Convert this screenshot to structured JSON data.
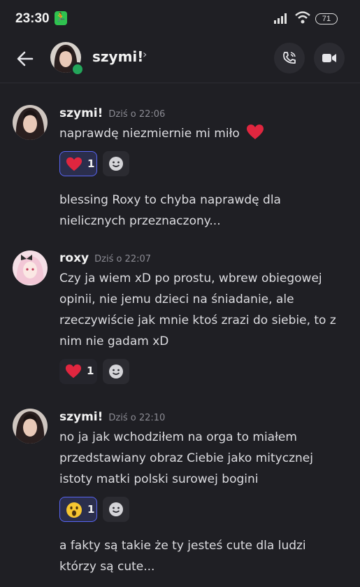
{
  "status_bar": {
    "time": "23:30",
    "battery": "71"
  },
  "header": {
    "name": "szymi!",
    "chevron": "›"
  },
  "messages": [
    {
      "author": "szymi!",
      "timestamp": "Dziś o 22:06",
      "lines": [
        "naprawdę niezmiernie mi miło"
      ],
      "reaction": {
        "emoji": "red-heart",
        "count": "1"
      },
      "followup": [
        "blessing Roxy to chyba naprawdę dla",
        "nielicznych przeznaczony..."
      ]
    },
    {
      "author": "roxy",
      "timestamp": "Dziś o 22:07",
      "lines": [
        "Czy ja wiem xD po prostu, wbrew obiegowej",
        "opinii, nie jemu dzieci na śniadanie, ale",
        "rzeczywiście jak mnie ktoś zrazi do siebie, to z",
        "nim nie gadam xD"
      ],
      "reaction": {
        "emoji": "red-heart",
        "count": "1"
      }
    },
    {
      "author": "szymi!",
      "timestamp": "Dziś o 22:10",
      "lines": [
        "no ja jak wchodziłem na orga to miałem",
        "przedstawiany obraz Ciebie jako mitycznej",
        "istoty matki polski surowej bogini"
      ],
      "reaction": {
        "emoji": "astonished-face",
        "count": "1"
      },
      "followup": [
        "a fakty są takie że ty jesteś cute dla ludzi",
        "którzy są cute..."
      ]
    }
  ],
  "colors": {
    "accent": "#5865f2",
    "online": "#23a55a",
    "heart": "#e0263f"
  }
}
